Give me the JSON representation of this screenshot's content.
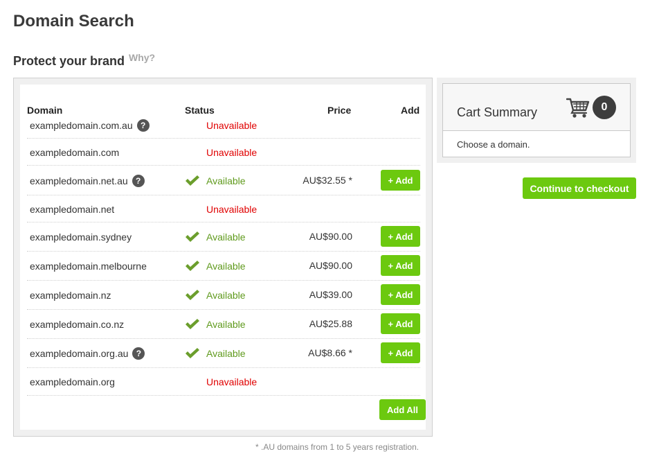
{
  "page": {
    "title": "Domain Search",
    "section_title": "Protect your brand",
    "why_link": "Why?"
  },
  "table": {
    "headers": {
      "domain": "Domain",
      "status": "Status",
      "price": "Price",
      "add": "Add"
    },
    "rows": [
      {
        "domain": "exampledomain.com.au",
        "help": true,
        "status": "Unavailable",
        "available": false,
        "price": ""
      },
      {
        "domain": "exampledomain.com",
        "help": false,
        "status": "Unavailable",
        "available": false,
        "price": ""
      },
      {
        "domain": "exampledomain.net.au",
        "help": true,
        "status": "Available",
        "available": true,
        "price": "AU$32.55 *"
      },
      {
        "domain": "exampledomain.net",
        "help": false,
        "status": "Unavailable",
        "available": false,
        "price": ""
      },
      {
        "domain": "exampledomain.sydney",
        "help": false,
        "status": "Available",
        "available": true,
        "price": "AU$90.00"
      },
      {
        "domain": "exampledomain.melbourne",
        "help": false,
        "status": "Available",
        "available": true,
        "price": "AU$90.00"
      },
      {
        "domain": "exampledomain.nz",
        "help": false,
        "status": "Available",
        "available": true,
        "price": "AU$39.00"
      },
      {
        "domain": "exampledomain.co.nz",
        "help": false,
        "status": "Available",
        "available": true,
        "price": "AU$25.88"
      },
      {
        "domain": "exampledomain.org.au",
        "help": true,
        "status": "Available",
        "available": true,
        "price": "AU$8.66 *"
      },
      {
        "domain": "exampledomain.org",
        "help": false,
        "status": "Unavailable",
        "available": false,
        "price": ""
      }
    ],
    "add_button_label": "+ Add",
    "help_icon_glyph": "?",
    "add_all_label": "Add All"
  },
  "footnote": "* .AU domains from 1 to 5 years registration.",
  "cart": {
    "title": "Cart Summary",
    "count": "0",
    "empty_message": "Choose a domain.",
    "checkout_label": "Continue to checkout"
  },
  "colors": {
    "accent_green": "#6cc90f",
    "available_green": "#5f9a1c",
    "unavailable_red": "#e00000",
    "check_icon": "#6b9e2c"
  },
  "icons": {
    "help": "question-circle-icon",
    "available": "checkmark-icon",
    "cart": "shopping-cart-icon"
  }
}
